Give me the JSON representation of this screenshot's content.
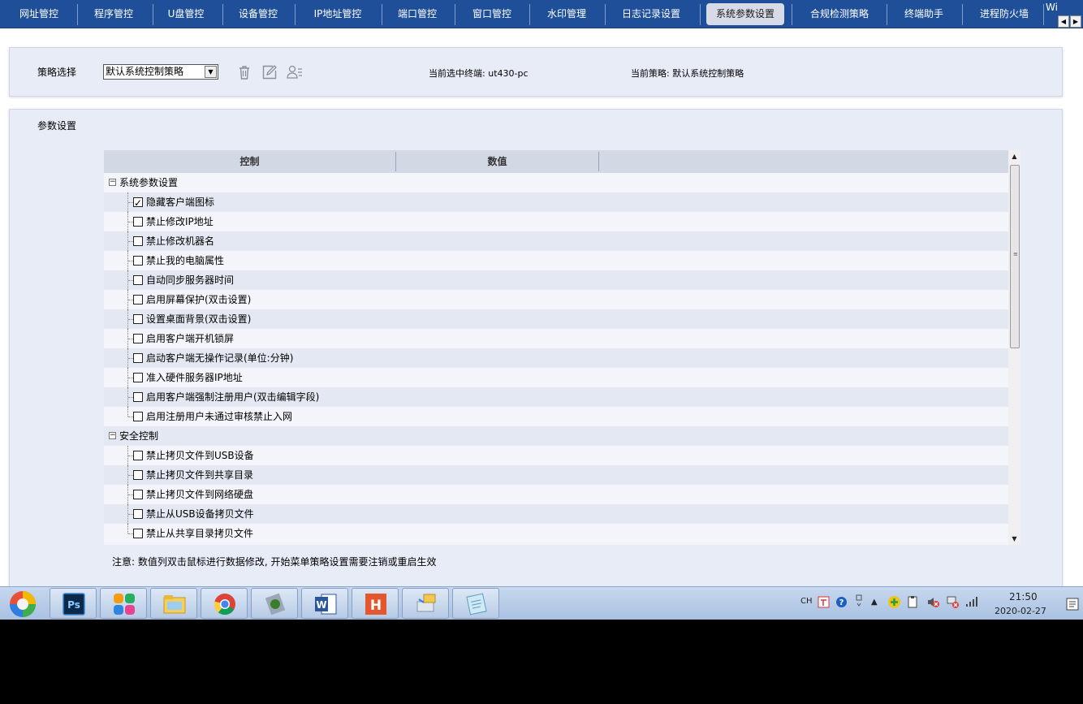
{
  "tabs": [
    {
      "label": "网址管控",
      "active": false
    },
    {
      "label": "程序管控",
      "active": false
    },
    {
      "label": "U盘管控",
      "active": false
    },
    {
      "label": "设备管控",
      "active": false
    },
    {
      "label": "IP地址管控",
      "active": false
    },
    {
      "label": "端口管控",
      "active": false
    },
    {
      "label": "窗口管控",
      "active": false
    },
    {
      "label": "水印管理",
      "active": false
    },
    {
      "label": "日志记录设置",
      "active": false
    },
    {
      "label": "系统参数设置",
      "active": true
    },
    {
      "label": "合规检测策略",
      "active": false
    },
    {
      "label": "终端助手",
      "active": false
    },
    {
      "label": "进程防火墙",
      "active": false
    }
  ],
  "tab_overflow_text": "Wif",
  "policy": {
    "label": "策略选择",
    "selected": "默认系统控制策略",
    "current_terminal_label": "当前选中终端:",
    "current_terminal_value": "ut430-pc",
    "current_policy_label": "当前策略:",
    "current_policy_value": "默认系统控制策略",
    "icons": [
      "trash-icon",
      "edit-icon",
      "user-list-icon"
    ]
  },
  "params": {
    "label": "参数设置",
    "columns": [
      "控制",
      "数值",
      ""
    ],
    "groups": [
      {
        "name": "系统参数设置",
        "expanded": true,
        "items": [
          {
            "label": "隐藏客户端图标",
            "checked": true,
            "value": ""
          },
          {
            "label": "禁止修改IP地址",
            "checked": false,
            "value": ""
          },
          {
            "label": "禁止修改机器名",
            "checked": false,
            "value": ""
          },
          {
            "label": "禁止我的电脑属性",
            "checked": false,
            "value": ""
          },
          {
            "label": "自动同步服务器时间",
            "checked": false,
            "value": ""
          },
          {
            "label": "启用屏幕保护(双击设置)",
            "checked": false,
            "value": ""
          },
          {
            "label": "设置桌面背景(双击设置)",
            "checked": false,
            "value": ""
          },
          {
            "label": "启用客户端开机锁屏",
            "checked": false,
            "value": ""
          },
          {
            "label": "启动客户端无操作记录(单位:分钟)",
            "checked": false,
            "value": ""
          },
          {
            "label": "准入硬件服务器IP地址",
            "checked": false,
            "value": ""
          },
          {
            "label": "启用客户端强制注册用户(双击编辑字段)",
            "checked": false,
            "value": ""
          },
          {
            "label": "启用注册用户未通过审核禁止入网",
            "checked": false,
            "value": ""
          }
        ]
      },
      {
        "name": "安全控制",
        "expanded": true,
        "items": [
          {
            "label": "禁止拷贝文件到USB设备",
            "checked": false,
            "value": ""
          },
          {
            "label": "禁止拷贝文件到共享目录",
            "checked": false,
            "value": ""
          },
          {
            "label": "禁止拷贝文件到网络硬盘",
            "checked": false,
            "value": ""
          },
          {
            "label": "禁止从USB设备拷贝文件",
            "checked": false,
            "value": ""
          },
          {
            "label": "禁止从共享目录拷贝文件",
            "checked": false,
            "value": ""
          }
        ]
      }
    ],
    "note": "注意: 数值列双击鼠标进行数据修改, 开始菜单策略设置需要注销或重启生效"
  },
  "taskbar": {
    "apps": [
      "photoshop-icon",
      "app-grid-icon",
      "file-explorer-icon",
      "chrome-icon",
      "tools-icon",
      "word-icon",
      "h-app-icon",
      "network-icon",
      "notepad-icon"
    ],
    "ps_label": "Ps",
    "word_label": "W",
    "h_label": "H",
    "tray_lang": "CH",
    "time": "21:50",
    "date": "2020-02-27"
  },
  "colors": {
    "tabbar": "#1f4f98",
    "panel": "#e8ecf7",
    "grid_header": "#d3d8e5",
    "row_alt": "#e4e8f2"
  }
}
